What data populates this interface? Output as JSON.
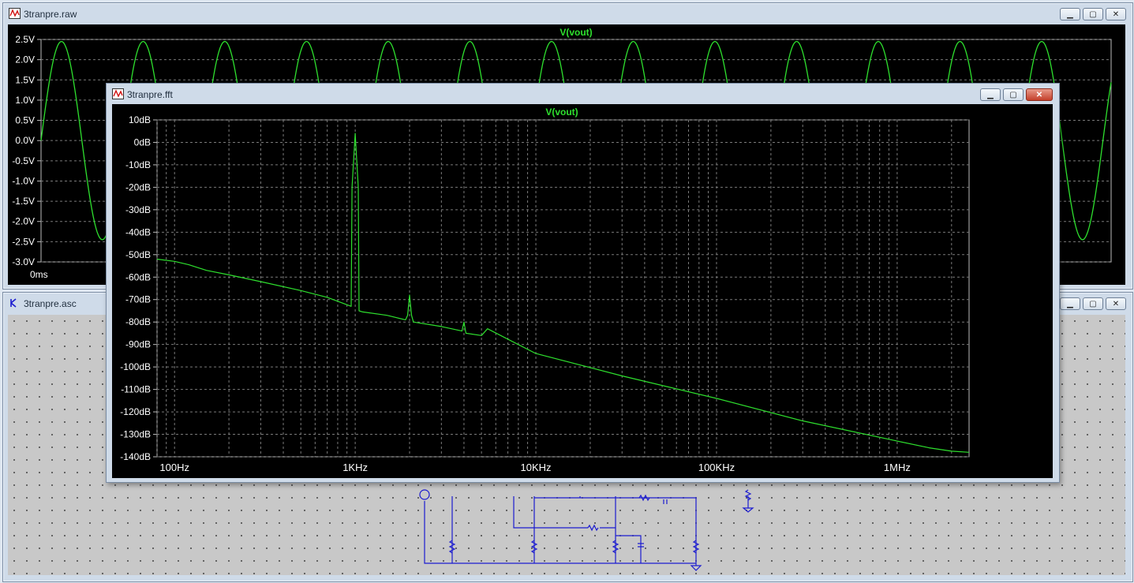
{
  "raw_window": {
    "title": "3tranpre.raw",
    "trace_label": "V(vout)",
    "x_tick_first": "0ms",
    "y_ticks": [
      "2.5V",
      "2.0V",
      "1.5V",
      "1.0V",
      "0.5V",
      "0.0V",
      "-0.5V",
      "-1.0V",
      "-1.5V",
      "-2.0V",
      "-2.5V",
      "-3.0V"
    ]
  },
  "asc_window": {
    "title": "3tranpre.asc"
  },
  "fft_window": {
    "title": "3tranpre.fft",
    "trace_label": "V(vout)"
  },
  "buttons": {
    "minimize": "▁",
    "maximize": "▢",
    "close": "✕"
  },
  "colors": {
    "trace": "#2ee02e",
    "grid": "#7a7a7a",
    "plot_bg": "#000000",
    "schematic_wire": "#1c1cd0"
  },
  "chart_data": [
    {
      "type": "line",
      "title": "V(vout)",
      "ylim": [
        -3.0,
        2.5
      ],
      "y_tick_labels": [
        "2.5V",
        "2.0V",
        "1.5V",
        "1.0V",
        "0.5V",
        "0.0V",
        "-0.5V",
        "-1.0V",
        "-1.5V",
        "-2.0V",
        "-2.5V",
        "-3.0V"
      ],
      "x_tick_labels": [
        "0ms"
      ],
      "series": [
        {
          "name": "V(vout)",
          "shape": "clipped sine",
          "peak": 2.45,
          "trough": -2.45,
          "visible_cycles": 13.1
        }
      ]
    },
    {
      "type": "line",
      "title": "V(vout)",
      "x_scale": "log",
      "xlim": [
        80,
        2500000
      ],
      "ylim": [
        -140,
        10
      ],
      "x_tick_labels": [
        "100Hz",
        "1KHz",
        "10KHz",
        "100KHz",
        "1MHz"
      ],
      "y_tick_labels": [
        "10dB",
        "0dB",
        "-10dB",
        "-20dB",
        "-30dB",
        "-40dB",
        "-50dB",
        "-60dB",
        "-70dB",
        "-80dB",
        "-90dB",
        "-100dB",
        "-110dB",
        "-120dB",
        "-130dB",
        "-140dB"
      ],
      "series": [
        {
          "name": "V(vout)",
          "x": [
            80,
            100,
            120,
            150,
            200,
            300,
            500,
            700,
            950,
            960,
            1000,
            1040,
            1050,
            1100,
            1500,
            1900,
            1950,
            2000,
            2050,
            2100,
            3000,
            3900,
            4000,
            4100,
            5000,
            5400,
            10000,
            30000,
            100000,
            300000,
            1000000,
            1500000,
            2000000,
            2500000
          ],
          "y": [
            -52,
            -53,
            -54.5,
            -57,
            -59,
            -62,
            -66,
            -69,
            -73,
            -20,
            4,
            -20,
            -75,
            -75.5,
            -77,
            -79,
            -77,
            -68,
            -77,
            -80,
            -82,
            -84,
            -80,
            -85,
            -86,
            -83,
            -94,
            -104,
            -114,
            -124,
            -133,
            -136,
            -137.5,
            -138
          ]
        }
      ]
    }
  ]
}
